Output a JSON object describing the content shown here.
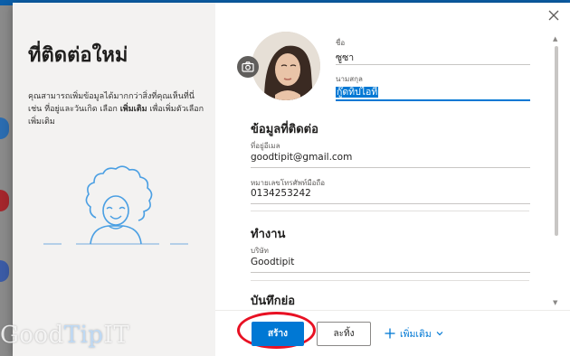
{
  "dialog": {
    "title": "ที่ติดต่อใหม่",
    "description_parts": [
      "คุณสามารถเพิ่มข้อมูลได้มากกว่าสิ่งที่คุณเห็นที่นี่ เช่น ที่อยู่และวันเกิด เลือก ",
      "เพิ่มเติม",
      " เพื่อเพิ่มตัวเลือกเพิ่มเติม"
    ]
  },
  "fields": {
    "first_name_label": "ชื่อ",
    "first_name_value": "ซูซา",
    "last_name_label": "นามสกุล",
    "last_name_value": "กู๊ดทิปไอที"
  },
  "contact_section": {
    "title": "ข้อมูลที่ติดต่อ",
    "email_label": "ที่อยู่อีเมล",
    "email_value": "goodtipit@gmail.com",
    "phone_label": "หมายเลขโทรศัพท์มือถือ",
    "phone_value": "0134253242"
  },
  "work_section": {
    "title": "ทำงาน",
    "company_label": "บริษัท",
    "company_value": "Goodtipit"
  },
  "notes_section": {
    "title": "บันทึกย่อ"
  },
  "footer": {
    "create_label": "สร้าง",
    "cancel_label": "ละทิ้ง",
    "more_label": "เพิ่มเติม"
  },
  "icons": {
    "close": "close-icon",
    "camera": "camera-icon",
    "plus": "plus-icon",
    "chevron": "chevron-down-icon"
  },
  "colors": {
    "accent": "#0078d4",
    "highlight_circle": "#e81123"
  },
  "watermark": {
    "text_a": "Good",
    "text_b": "Tip",
    "text_c": "IT"
  }
}
